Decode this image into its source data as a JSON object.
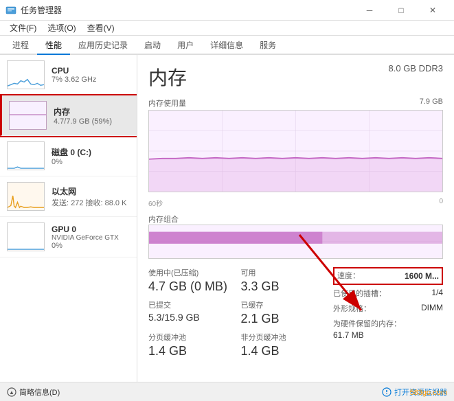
{
  "window": {
    "title": "任务管理器",
    "minimize_label": "─",
    "maximize_label": "□",
    "close_label": "✕"
  },
  "menu": {
    "items": [
      "文件(F)",
      "选项(O)",
      "查看(V)"
    ]
  },
  "tabs": {
    "items": [
      "进程",
      "性能",
      "应用历史记录",
      "启动",
      "用户",
      "详细信息",
      "服务"
    ],
    "active": "性能"
  },
  "sidebar": {
    "items": [
      {
        "id": "cpu",
        "title": "CPU",
        "subtitle": "7% 3.62 GHz",
        "active": false
      },
      {
        "id": "memory",
        "title": "内存",
        "subtitle": "4.7/7.9 GB (59%)",
        "active": true
      },
      {
        "id": "disk",
        "title": "磁盘 0 (C:)",
        "subtitle": "0%",
        "active": false
      },
      {
        "id": "ethernet",
        "title": "以太网",
        "subtitle": "发送: 272 接收: 88.0 K",
        "active": false
      },
      {
        "id": "gpu",
        "title": "GPU 0",
        "subtitle": "NVIDIA GeForce GTX",
        "subtitle2": "0%",
        "active": false
      }
    ]
  },
  "content": {
    "title": "内存",
    "subtitle": "8.0 GB DDR3",
    "usage_chart_label": "内存使用量",
    "usage_chart_max": "7.9 GB",
    "time_label_left": "60秒",
    "time_label_right": "0",
    "combo_chart_label": "内存组合",
    "stats": {
      "used": {
        "label": "使用中(已压缩)",
        "value": "4.7 GB (0 MB)"
      },
      "available": {
        "label": "可用",
        "value": "3.3 GB"
      },
      "committed": {
        "label": "已提交",
        "value": "5.3/15.9 GB"
      },
      "cached": {
        "label": "已缓存",
        "value": "2.1 GB"
      },
      "paged_pool": {
        "label": "分页缓冲池",
        "value": "1.4 GB"
      },
      "non_paged_pool": {
        "label": "非分页缓冲池",
        "value": "1.4 GB"
      }
    },
    "right_stats": {
      "speed": {
        "label": "速度：",
        "value": "1600 M..."
      },
      "slots_used": {
        "label": "已使用的插槽：",
        "value": "1/4"
      },
      "form_factor": {
        "label": "外形规格：",
        "value": "DIMM"
      },
      "hardware_reserved": {
        "label": "为硬件保留的内存：",
        "value": "61.7 MB"
      }
    }
  },
  "bottom": {
    "summary_label": "简略信息(D)",
    "monitor_label": "打开资源监视器"
  },
  "watermark": "583go.com"
}
